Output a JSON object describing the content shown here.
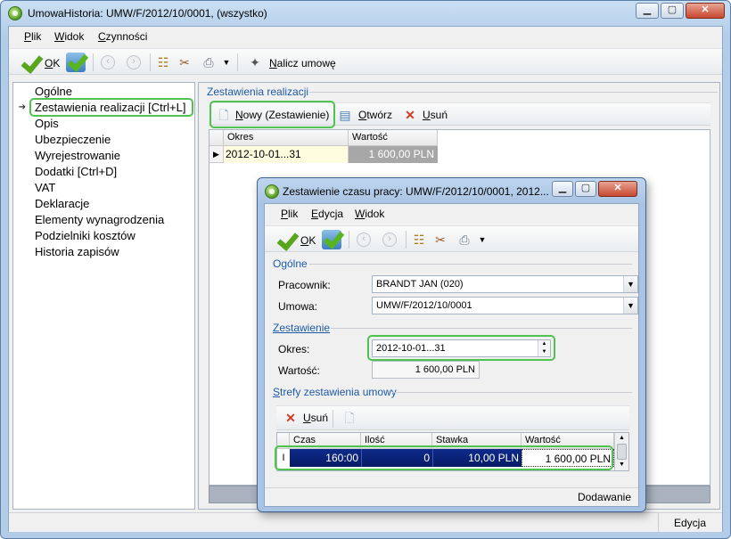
{
  "main": {
    "title": "UmowaHistoria: UMW/F/2012/10/0001, (wszystko)",
    "menu": [
      {
        "pre": "",
        "u": "P",
        "post": "lik"
      },
      {
        "pre": "",
        "u": "W",
        "post": "idok"
      },
      {
        "pre": "",
        "u": "C",
        "post": "zynności"
      }
    ],
    "toolbar": {
      "ok_u": "O",
      "ok_rest": "K",
      "calc_u": "N",
      "calc_rest": "alicz umowę"
    },
    "nav": [
      "Ogólne",
      "Zestawienia realizacji [Ctrl+L]",
      "Opis",
      "Ubezpieczenie",
      "Wyrejestrowanie",
      "Dodatki [Ctrl+D]",
      "VAT",
      "Deklaracje",
      "Elementy wynagrodzenia",
      "Podzielniki kosztów",
      "Historia zapisów"
    ],
    "group_title": "Zestawienia realizacji",
    "actions": {
      "new_u": "N",
      "new_rest": "owy (Zestawienie)",
      "open_u": "O",
      "open_rest": "twórz",
      "del_u": "U",
      "del_rest": "suń"
    },
    "grid": {
      "headers": [
        "Okres",
        "Wartość"
      ],
      "row": {
        "okres": "2012-10-01...31",
        "wartosc": "1 600,00 PLN"
      }
    },
    "status": "Edycja"
  },
  "dialog": {
    "title": "Zestawienie czasu pracy: UMW/F/2012/10/0001, 2012...",
    "menu": [
      {
        "pre": "",
        "u": "P",
        "post": "lik"
      },
      {
        "pre": "",
        "u": "E",
        "post": "dycja"
      },
      {
        "pre": "",
        "u": "W",
        "post": "idok"
      }
    ],
    "ok_u": "O",
    "ok_rest": "K",
    "group_general": "Ogólne",
    "pracownik_label": "Pracownik:",
    "pracownik_value": "BRANDT JAN (020)",
    "umowa_label": "Umowa:",
    "umowa_value": "UMW/F/2012/10/0001",
    "group_zestawienie": "Zestawienie",
    "okres_label": "Okres:",
    "okres_value": "2012-10-01...31",
    "wartosc_label": "Wartość:",
    "wartosc_value": "1 600,00 PLN",
    "group_strefy_u": "S",
    "group_strefy_rest": "trefy zestawienia umowy",
    "del_u": "U",
    "del_rest": "suń",
    "grid": {
      "headers": [
        "Czas",
        "Ilość",
        "Stawka",
        "Wartość"
      ],
      "row": {
        "czas": "160:00",
        "ilosc": "0",
        "stawka": "10,00 PLN",
        "wartosc": "1 600,00 PLN"
      }
    },
    "status": "Dodawanie"
  }
}
